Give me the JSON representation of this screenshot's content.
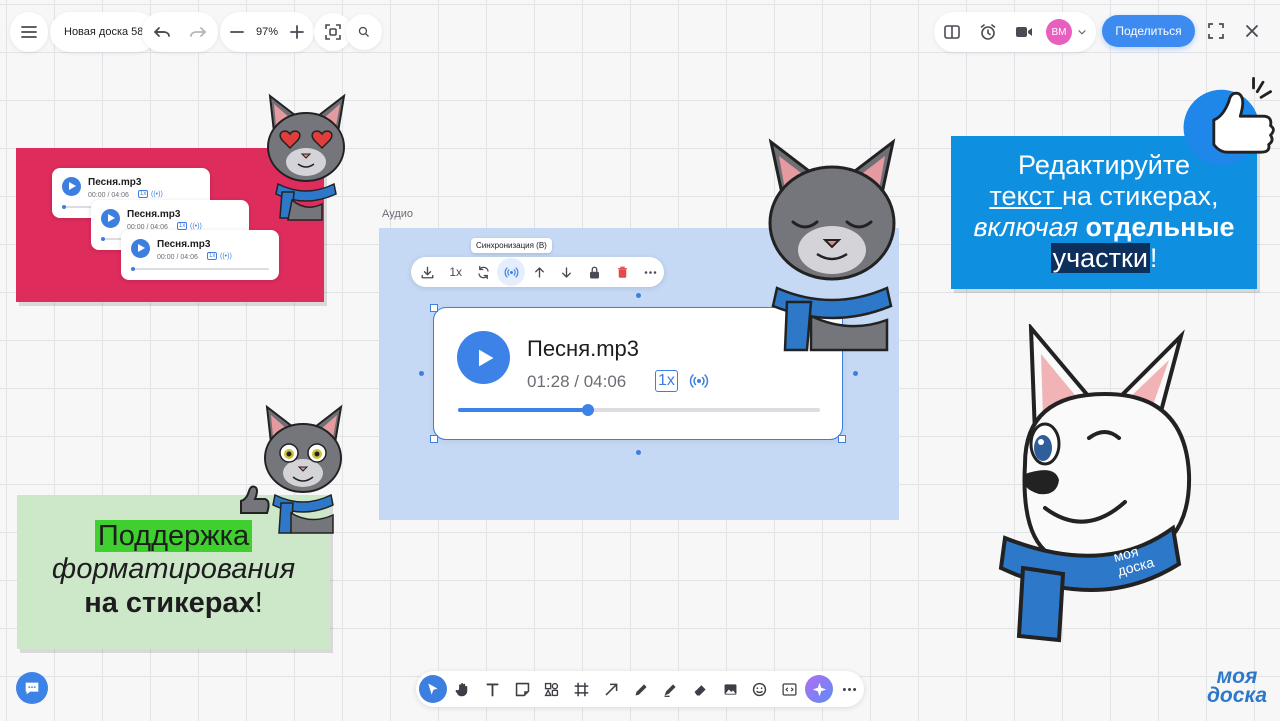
{
  "topbar": {
    "board_name": "Новая доска 58",
    "zoom": "97%",
    "avatar_initials": "ВМ",
    "share_label": "Поделиться"
  },
  "audio_group_left": {
    "cards": [
      {
        "name": "Песня.mp3",
        "time": "00:00 / 04:06",
        "speed": "1x"
      },
      {
        "name": "Песня.mp3",
        "time": "00:00 / 04:06",
        "speed": "1x"
      },
      {
        "name": "Песня.mp3",
        "time": "00:00 / 04:06",
        "speed": "1x"
      }
    ]
  },
  "audio_widget": {
    "frame_label": "Аудио",
    "tooltip": "Синхронизация (В)",
    "speed_button": "1x",
    "file_name": "Песня.mp3",
    "time": "01:28 / 04:06",
    "speed_badge": "1x",
    "progress": 0.36
  },
  "sticker_right": {
    "line1": "Редактируйте",
    "line2_underlined": "текст ",
    "line2_rest": "на стикерах,",
    "line3_italic": "включая ",
    "line3_bold": "отдельные",
    "line4_highlight": "участки",
    "line4_rest": "!"
  },
  "sticker_left": {
    "line1_highlight": "Поддержка",
    "line2_italic": "форматирования",
    "line3_bold": "на стикерах",
    "line3_rest": "!"
  },
  "logo": {
    "line1": "моя",
    "line2": "доска"
  },
  "scarf_logo": {
    "line1": "моя",
    "line2": "доска"
  },
  "colors": {
    "accent": "#3d8bf0",
    "sticker_red": "#de2c5d",
    "sticker_blue": "#0f8fe0",
    "sticker_green": "#cde8c8",
    "frame_blue": "#c5d9f5",
    "avatar": "#e95fc0"
  }
}
